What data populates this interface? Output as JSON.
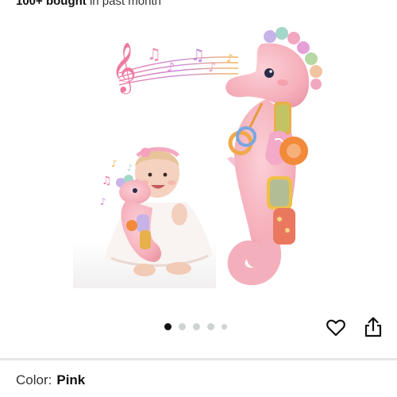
{
  "purchase_info": {
    "bought_count": "100+ bought",
    "bought_suffix": "in past month"
  },
  "gallery": {
    "image_alt": "Pink plush seahorse toy with baby",
    "dots_total": 5,
    "active_index": 0
  },
  "actions": {
    "favorite_icon": "heart-icon",
    "share_icon": "share-icon"
  },
  "variant": {
    "label": "Color:",
    "value": "Pink"
  },
  "colors": {
    "text": "#0f1111",
    "plush_pink": "#f6b6c0",
    "dot_active": "#0f1111",
    "dot_inactive": "#cfd3d3"
  }
}
